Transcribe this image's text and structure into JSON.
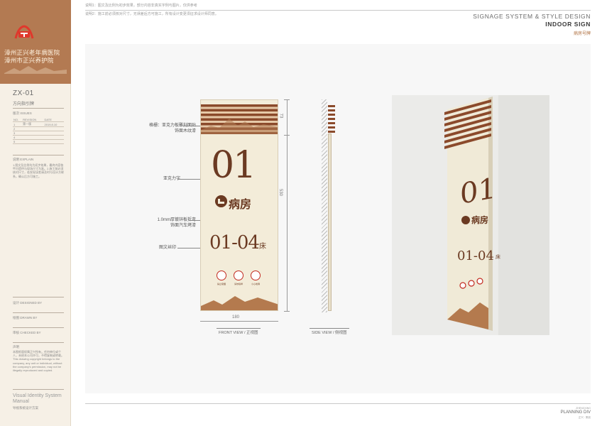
{
  "sidebar": {
    "brand_name_1": "漳州正兴老年病医院",
    "brand_name_2": "漳州市正兴养护院",
    "code": "ZX-01",
    "code_subtitle": "方向指引牌",
    "issues_label": "版次 ISSUES",
    "issues_header": [
      "NO.",
      "REVISION",
      "DATE"
    ],
    "issues_rows": [
      [
        "1",
        "第一版",
        "2019.8.10"
      ],
      [
        "2",
        "",
        ""
      ],
      [
        "3",
        "",
        ""
      ],
      [
        "4",
        "",
        ""
      ],
      [
        "5",
        "",
        ""
      ]
    ],
    "explain_label": "说明 EXPLAIN",
    "explain_text": "1.图文及比例均为初步效果，最终内容依甲方提供与现场尺寸为准。2.施工前必须核对尺寸，若发现误差请及时与设计方联系，确认后方可施工。",
    "designed_by": "设计 DESIGNED BY",
    "drawn_by": "绘图 DRAWN BY",
    "checked_by": "审核 CHECKED BY",
    "remark_label": "声明",
    "remark_text": "本图纸版权属正兴所有，任何单位或个人，未经本公司许可，不得复制或转载。This drawing copyright belongs to the company, any unit or individual, without the company's permission, may not be illegally reproduced and copied.",
    "vis_title": "Visual Identity System Manual",
    "vis_subtitle": "导视系统设计方案"
  },
  "header": {
    "note_1": "说明1：图文及比例为初步效果，部分内容非真实字例与图片，仅供参考",
    "note_2": "说明2：施工前必须核对尺寸，无误差后方可施工，所有设计变更须征求设计师同意。",
    "title": "SIGNAGE SYSTEM & STYLE DESIGN",
    "subtitle": "INDOOR SIGN",
    "subtitle_cn": "病房号牌"
  },
  "sign": {
    "number": "01",
    "room_label": "病房",
    "bed_range": "01-04",
    "bed_unit": "床",
    "warnings": [
      "禁止吸烟",
      "请勿喧哗",
      "小心地滑"
    ]
  },
  "callouts": {
    "top_1": "格栅：亚克力板雕刻面贴",
    "top_2": "饰面木纹漆",
    "acrylic": "亚克力字",
    "plate_1": "1.0mm厚镀锌板折弯",
    "plate_2": "饰面汽车烤漆",
    "print": "图文丝印"
  },
  "dimensions": {
    "top_height": "73",
    "body_height": "530",
    "width": "180"
  },
  "views": {
    "front": "FRONT VIEW / 正视图",
    "side": "SIDE VIEW / 侧视图"
  },
  "footer": {
    "line1": "ZHENGXING",
    "line2": "PLANNING DIV",
    "line3": "正兴 · 策划"
  }
}
